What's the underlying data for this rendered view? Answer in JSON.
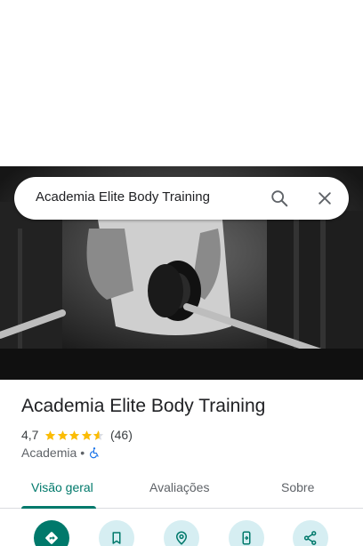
{
  "search": {
    "query": "Academia Elite Body Training"
  },
  "place": {
    "name": "Academia Elite Body Training",
    "rating": "4,7",
    "rating_value": 4.7,
    "review_count": "(46)",
    "category": "Academia",
    "separator": "•"
  },
  "tabs": [
    {
      "label": "Visão geral",
      "active": true
    },
    {
      "label": "Avaliações",
      "active": false
    },
    {
      "label": "Sobre",
      "active": false
    }
  ],
  "actions": [
    "directions-icon",
    "save-icon",
    "nearby-icon",
    "send-to-phone-icon",
    "share-icon"
  ],
  "colors": {
    "accent": "#00796b",
    "star": "#fbbc04",
    "action_bg": "#d6eef2"
  }
}
